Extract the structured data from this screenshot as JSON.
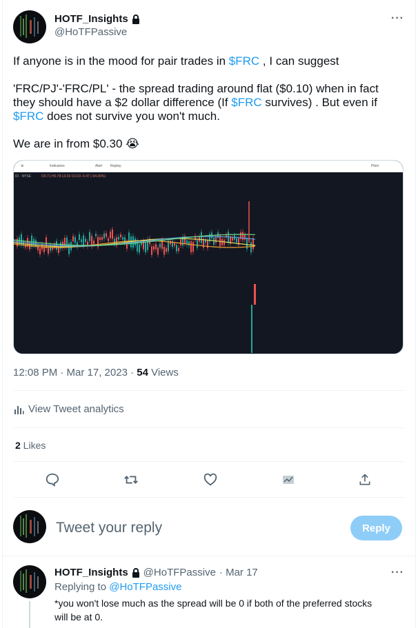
{
  "tweet": {
    "author": {
      "name": "HOTF_Insights",
      "handle": "@HoTFPassive",
      "locked": true
    },
    "text_1_prefix": "If anyone is in the mood for pair trades in ",
    "text_1_tag": "$FRC",
    "text_1_suffix": " , I can suggest",
    "text_2_part1": "'FRC/PJ'-'FRC/PL' - the spread trading around flat ($0.10) when in fact they should have a $2 dollar difference (If ",
    "text_2_tag1": "$FRC",
    "text_2_part2": " survives) . But even if ",
    "text_2_tag2": "$FRC",
    "text_2_part3": " does not survive you won't much.",
    "text_3": "We are in from $0.30 ",
    "emoji": "😭",
    "chart": {
      "toolbar": {
        "indicators": "Indicators",
        "alert": "Alert",
        "replay": "Replay",
        "pitch": "Pitch"
      },
      "symbol_line": "ID · NYSE",
      "ohlc": "O0.71  H0.78  L0.03  C0.03  -0.47 (-94.00%)"
    },
    "timestamp": "12:08 PM · Mar 17, 2023 · ",
    "views_count": "54",
    "views_label": " Views",
    "analytics_label": "View Tweet analytics",
    "likes_count": "2",
    "likes_label": " Likes"
  },
  "composer": {
    "placeholder": "Tweet your reply",
    "reply_button": "Reply"
  },
  "reply": {
    "author": {
      "name": "HOTF_Insights",
      "handle": "@HoTFPassive",
      "date": "· Mar 17"
    },
    "replying_to_prefix": "Replying to ",
    "replying_to_handle": "@HoTFPassive",
    "text": "*you won't lose much as the spread will be 0 if both of the preferred stocks will be at 0."
  },
  "colors": {
    "accent": "#1d9bf0",
    "text": "#0f1419",
    "muted": "#536471",
    "chart_bg": "#131722",
    "reply_button": "#8ecdf8"
  },
  "icons": [
    "lock-icon",
    "more-icon",
    "reply-icon",
    "retweet-icon",
    "like-icon",
    "analytics-icon",
    "share-icon",
    "analytics-bars-icon"
  ]
}
